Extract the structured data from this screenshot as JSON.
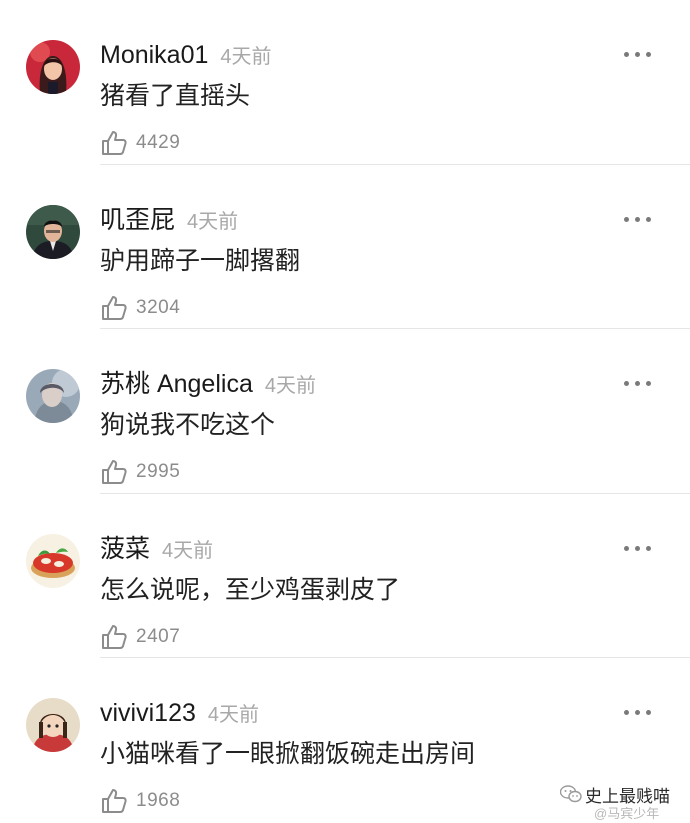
{
  "comments": [
    {
      "username": "Monika01",
      "time": "4天前",
      "text": "猪看了直摇头",
      "likes": "4429",
      "avatar_icon": "avatar-woman-red-background"
    },
    {
      "username": "叽歪屁",
      "time": "4天前",
      "text": "驴用蹄子一脚撂翻",
      "likes": "3204",
      "avatar_icon": "avatar-man-in-suit"
    },
    {
      "username": "苏桃 Angelica",
      "time": "4天前",
      "text": "狗说我不吃这个",
      "likes": "2995",
      "avatar_icon": "avatar-blurry-portrait"
    },
    {
      "username": "菠菜",
      "time": "4天前",
      "text": "怎么说呢，至少鸡蛋剥皮了",
      "likes": "2407",
      "avatar_icon": "avatar-tomato-sandwich"
    },
    {
      "username": "vivivi123",
      "time": "4天前",
      "text": "小猫咪看了一眼掀翻饭碗走出房间",
      "likes": "1968",
      "avatar_icon": "avatar-anime-girl"
    }
  ],
  "watermark": {
    "title": "史上最贱喵",
    "subtitle": "@马宾少年"
  },
  "colors": {
    "username": "#1a1a1a",
    "time": "#a8a8a8",
    "content": "#222222",
    "likes": "#8c8c8c",
    "divider": "#e6e6e6"
  }
}
